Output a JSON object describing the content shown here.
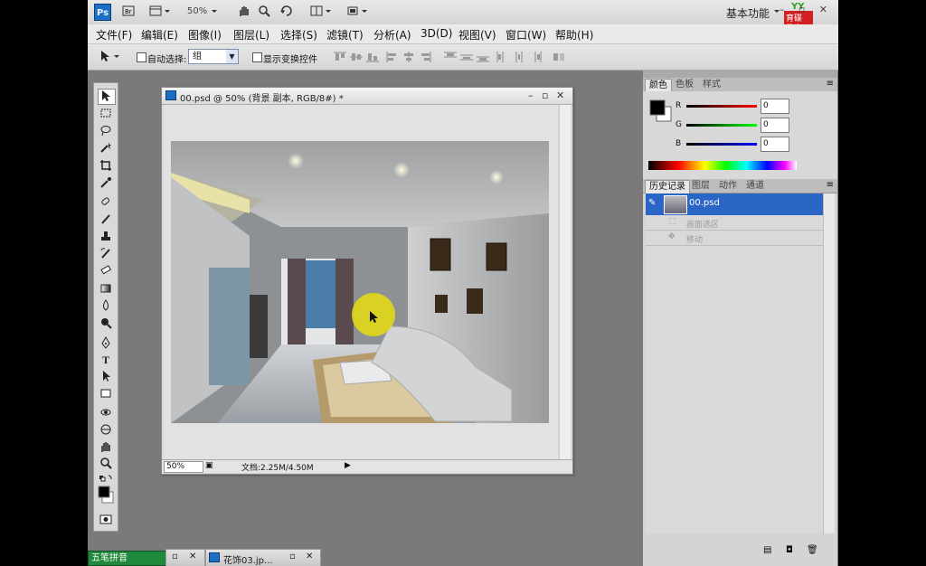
{
  "appbar": {
    "logo": "Ps",
    "zoom": "50%",
    "workspace": "基本功能",
    "brand_top": "YY",
    "brand_mid": "育碟",
    "brand_bottom": "教育"
  },
  "menu": [
    "文件(F)",
    "编辑(E)",
    "图像(I)",
    "图层(L)",
    "选择(S)",
    "滤镜(T)",
    "分析(A)",
    "3D(D)",
    "视图(V)",
    "窗口(W)",
    "帮助(H)"
  ],
  "options": {
    "auto_select_label": "自动选择:",
    "auto_select_value": "组",
    "show_transform_label": "显示变换控件"
  },
  "document": {
    "title": "00.psd @ 50% (背景 副本, RGB/8#) *",
    "zoom": "50%",
    "doc_info": "文档:2.25M/4.50M"
  },
  "color_panel": {
    "tabs": [
      "颜色",
      "色板",
      "样式"
    ],
    "channels": [
      {
        "label": "R",
        "value": "0",
        "color": "#d01010"
      },
      {
        "label": "G",
        "value": "0",
        "color": "#10a010"
      },
      {
        "label": "B",
        "value": "0",
        "color": "#1010d0"
      }
    ]
  },
  "history_panel": {
    "tabs": [
      "历史记录",
      "图层",
      "动作",
      "通道"
    ],
    "items": [
      {
        "label": "00.psd",
        "selected": true
      },
      {
        "label": "画面选区",
        "selected": false
      },
      {
        "label": "移动",
        "selected": false
      }
    ]
  },
  "taskbar": {
    "ime": "五笔拼音",
    "doc2": "花饰03.jp..."
  }
}
